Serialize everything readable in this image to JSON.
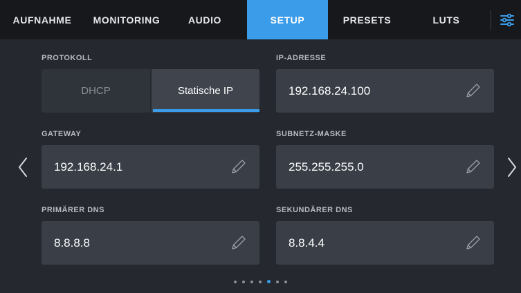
{
  "tabs": [
    {
      "label": "AUFNAHME",
      "active": false
    },
    {
      "label": "MONITORING",
      "active": false
    },
    {
      "label": "AUDIO",
      "active": false
    },
    {
      "label": "SETUP",
      "active": true
    },
    {
      "label": "PRESETS",
      "active": false
    },
    {
      "label": "LUTS",
      "active": false
    }
  ],
  "settings_icon": "sliders-icon",
  "accent_color": "#3b9cea",
  "protocol": {
    "label": "PROTOKOLL",
    "options": [
      "DHCP",
      "Statische IP"
    ],
    "selected": "Statische IP"
  },
  "fields": {
    "ip_address": {
      "label": "IP-ADRESSE",
      "value": "192.168.24.100"
    },
    "gateway": {
      "label": "GATEWAY",
      "value": "192.168.24.1"
    },
    "subnet_mask": {
      "label": "SUBNETZ-MASKE",
      "value": "255.255.255.0"
    },
    "primary_dns": {
      "label": "PRIMÄRER DNS",
      "value": "8.8.8.8"
    },
    "secondary_dns": {
      "label": "SEKUNDÄRER DNS",
      "value": "8.8.4.4"
    }
  },
  "edit_icon": "pencil-icon",
  "pagination": {
    "total_pages": 7,
    "current_page": 5
  }
}
